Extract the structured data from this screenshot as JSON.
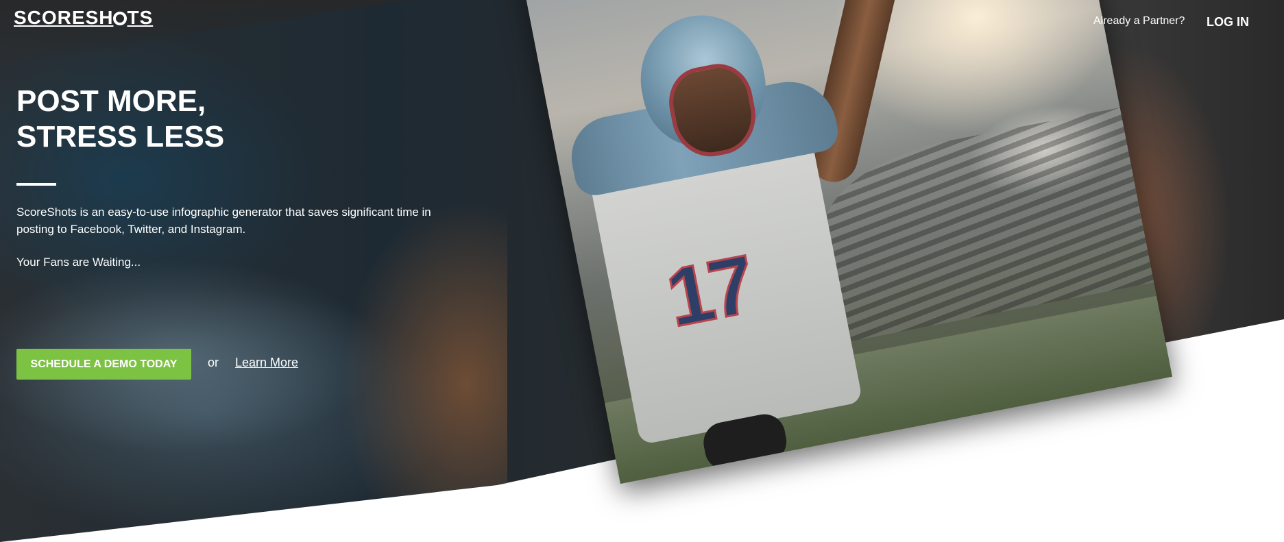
{
  "header": {
    "logo_text_before": "SCORESH",
    "logo_text_after": "TS",
    "partner_label": "Already a Partner?",
    "login_label": "LOG IN"
  },
  "hero": {
    "headline": "POST MORE,\nSTRESS LESS",
    "description": "ScoreShots is an easy-to-use infographic generator that saves significant time in posting to Facebook, Twitter, and Instagram.",
    "tagline": "Your Fans are Waiting...",
    "cta_label": "SCHEDULE A DEMO TODAY",
    "or_text": "or",
    "learn_more_label": "Learn More",
    "jersey_number": "17"
  },
  "colors": {
    "accent": "#7cc243",
    "dark_background": "#2b2b2b",
    "text": "#ffffff"
  },
  "icons": {
    "logo_mark": "shutter-ring-icon"
  }
}
